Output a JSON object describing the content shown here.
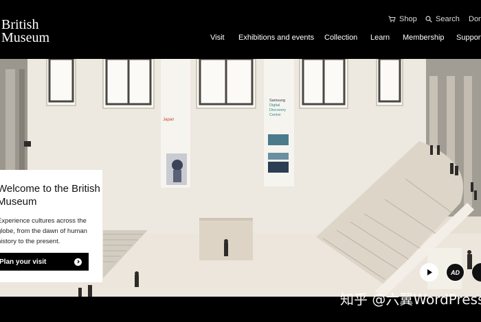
{
  "header": {
    "logo_line1": "British",
    "logo_line2": "Museum",
    "utility": {
      "shop": "Shop",
      "search": "Search",
      "donate": "Donate"
    },
    "nav": [
      "Visit",
      "Exhibitions and events",
      "Collection",
      "Learn",
      "Membership",
      "Support us"
    ]
  },
  "hero": {
    "banner_left_title": "Japan",
    "banner_right_line1": "Samsung",
    "banner_right_line2": "Digital",
    "banner_right_line3": "Discovery",
    "banner_right_line4": "Centre"
  },
  "card": {
    "title": "Welcome to the British Museum",
    "text": "Experience cultures across the globe, from the dawn of human history to the present.",
    "button": "Plan your visit"
  },
  "video_controls": {
    "ad_label": "AD"
  },
  "watermark": "知乎 @六翼WordPress"
}
